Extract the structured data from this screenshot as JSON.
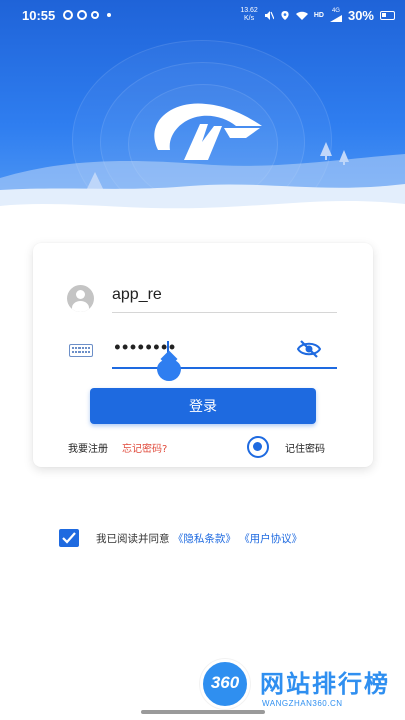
{
  "status_bar": {
    "time": "10:55",
    "net_speed_value": "13.62",
    "net_speed_unit": "K/s",
    "network_label": "HD",
    "network_type": "4G",
    "battery": "30%"
  },
  "login": {
    "username_value": "app_re",
    "password_masked": "••••••••",
    "login_button": "登录",
    "register_link": "我要注册",
    "forgot_link": "忘记密码?",
    "remember_label": "记住密码",
    "remember_checked": true
  },
  "agreement": {
    "checked": true,
    "prefix": "我已阅读并同意",
    "privacy_link": "《隐私条款》",
    "terms_link": "《用户协议》"
  },
  "watermark": {
    "badge": "360",
    "title": "网站排行榜",
    "url": "WANGZHAN360.CN"
  },
  "colors": {
    "primary": "#1e6ae0",
    "header_top": "#1f63d8",
    "link_red": "#e04a3b"
  }
}
